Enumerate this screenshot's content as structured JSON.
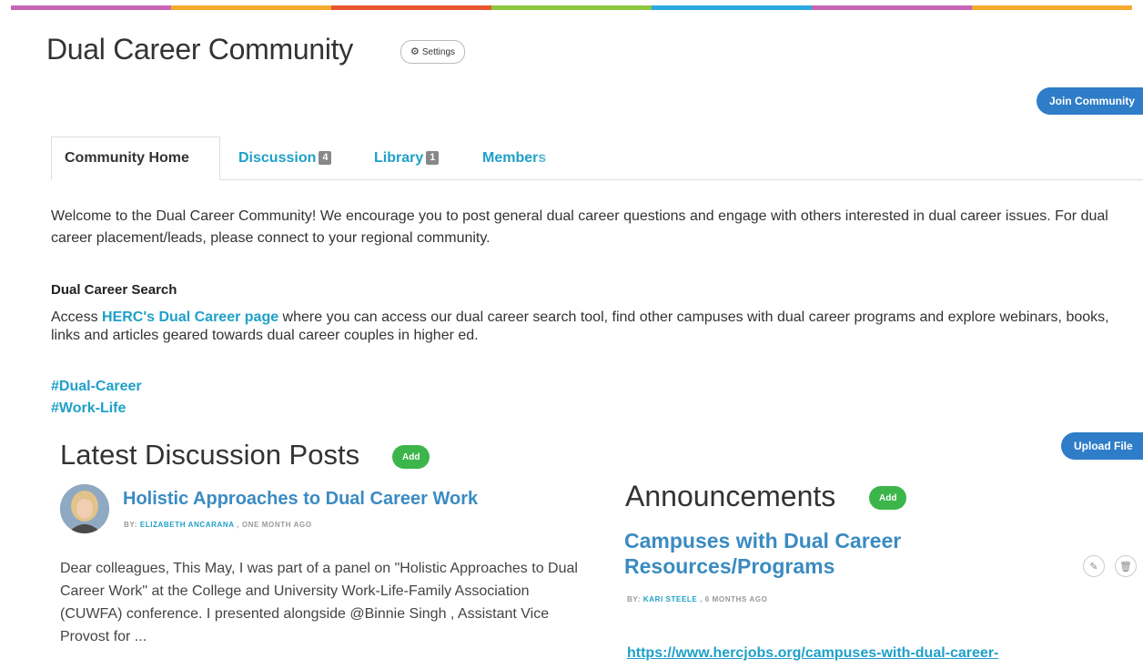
{
  "header": {
    "title": "Dual Career Community",
    "settings_label": "Settings",
    "join_label": "Join Community",
    "accent_colors": [
      "#c666b4",
      "#f4a92c",
      "#e8562f",
      "#8dc63f",
      "#2aa9de",
      "#c666b4",
      "#f4a92c"
    ]
  },
  "tabs": [
    {
      "label": "Community Home",
      "active": true
    },
    {
      "label": "Discussion",
      "count": "4"
    },
    {
      "label": "Library",
      "count": "1"
    },
    {
      "label": "Members"
    }
  ],
  "intro": {
    "text": "Welcome to the Dual Career Community! We encourage you to post general dual career questions and engage with others interested in dual career issues. For dual career placement/leads, please connect to your regional community."
  },
  "search": {
    "heading": "Dual Career Search",
    "prefix": "Access ",
    "link_text": "HERC's Dual Career page",
    "suffix": " where you can access our dual career search tool, find other campuses with dual career programs and explore webinars, books, links and articles geared towards dual career couples in higher ed."
  },
  "tags": [
    "#Dual-Career",
    "#Work-Life"
  ],
  "discussion": {
    "heading": "Latest Discussion Posts",
    "add_label": "Add",
    "upload_label": "Upload File",
    "post": {
      "title": "Holistic Approaches to Dual Career Work",
      "by_label": "BY: ",
      "author": "ELIZABETH ANCARANA",
      "time": " , ONE MONTH AGO",
      "excerpt": "Dear colleagues, This May, I was part of a panel on \"Holistic Approaches to Dual Career Work\" at  the College and University Work-Life-Family Association (CUWFA) conference. I presented alongside @Binnie Singh , Assistant Vice Provost for ..."
    }
  },
  "announcements": {
    "heading": "Announcements",
    "add_label": "Add",
    "item": {
      "title": "Campuses with Dual Career Resources/Programs",
      "by_label": "BY: ",
      "author": "KARI STEELE",
      "time": " , 6 MONTHS AGO",
      "link": "https://www.hercjobs.org/campuses-with-dual-career-"
    }
  }
}
